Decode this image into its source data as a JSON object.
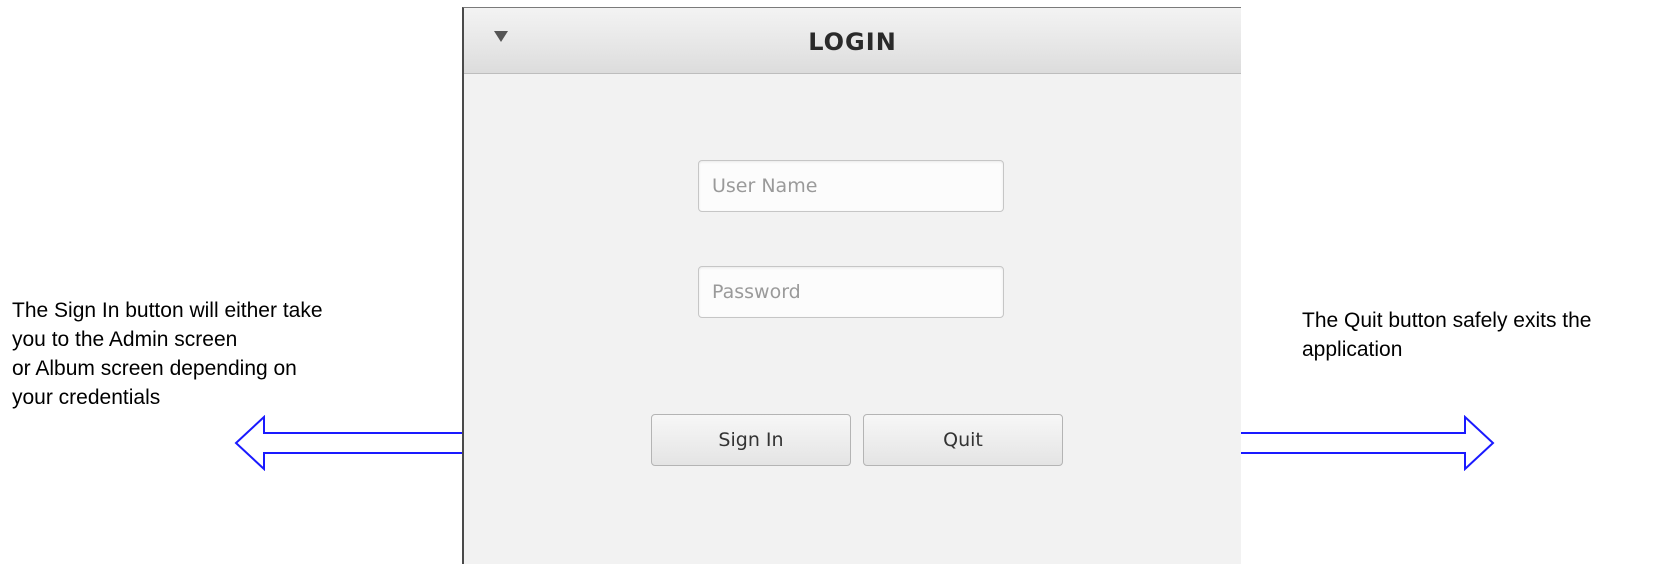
{
  "window": {
    "title": "LOGIN",
    "collapse_icon": "triangle-down-icon"
  },
  "form": {
    "username_placeholder": "User Name",
    "username_value": "",
    "password_placeholder": "Password",
    "password_value": ""
  },
  "buttons": {
    "signin_label": "Sign In",
    "quit_label": "Quit"
  },
  "annotations": {
    "left": {
      "lines": [
        "The Sign In button will either take",
        "you to the Admin screen",
        "or Album screen depending on",
        "your credentials"
      ]
    },
    "right": {
      "lines": [
        "The Quit button safely exits the",
        "application"
      ]
    }
  },
  "colors": {
    "arrow_stroke": "#1a1aff",
    "window_background": "#f2f2f2"
  }
}
